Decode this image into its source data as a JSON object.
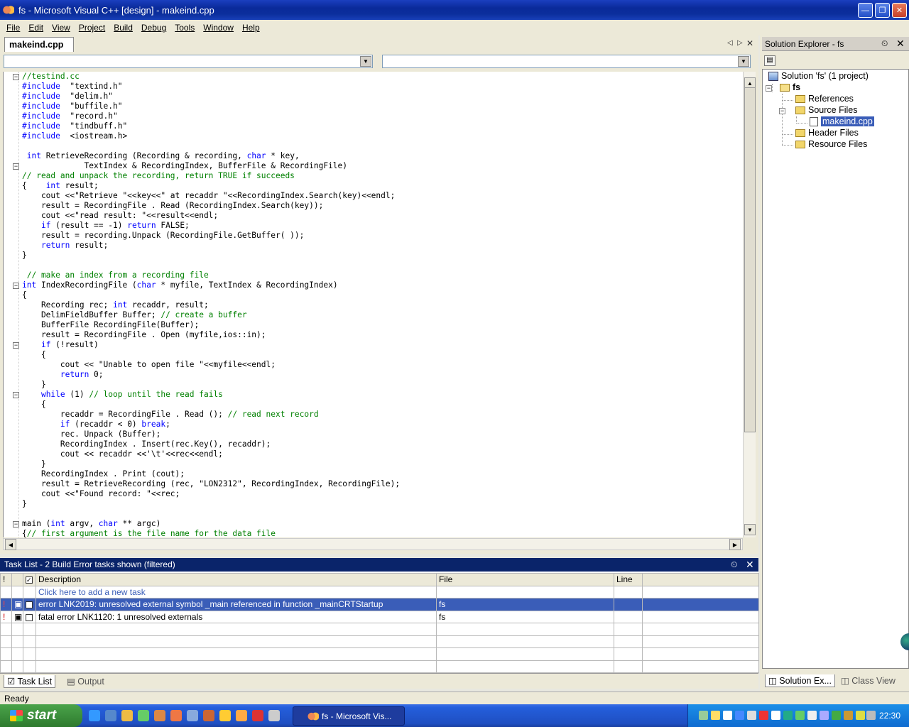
{
  "window": {
    "title": "fs - Microsoft Visual C++ [design] - makeind.cpp"
  },
  "menu": [
    "File",
    "Edit",
    "View",
    "Project",
    "Build",
    "Debug",
    "Tools",
    "Window",
    "Help"
  ],
  "editor": {
    "tab": "makeind.cpp",
    "lines": [
      [
        [
          "cm",
          "//testind.cc"
        ]
      ],
      [
        [
          "kw",
          "#include"
        ],
        [
          "",
          "  \"textind.h\""
        ]
      ],
      [
        [
          "kw",
          "#include"
        ],
        [
          "",
          "  \"delim.h\""
        ]
      ],
      [
        [
          "kw",
          "#include"
        ],
        [
          "",
          "  \"buffile.h\""
        ]
      ],
      [
        [
          "kw",
          "#include"
        ],
        [
          "",
          "  \"record.h\""
        ]
      ],
      [
        [
          "kw",
          "#include"
        ],
        [
          "",
          "  \"tindbuff.h\""
        ]
      ],
      [
        [
          "kw",
          "#include"
        ],
        [
          "",
          "  <iostream.h>"
        ]
      ],
      [
        [
          "",
          ""
        ]
      ],
      [
        [
          "kw",
          " int"
        ],
        [
          "",
          " RetrieveRecording (Recording & recording, "
        ],
        [
          "kw",
          "char"
        ],
        [
          "",
          " * key,"
        ]
      ],
      [
        [
          "",
          "             TextIndex & RecordingIndex, BufferFile & RecordingFile)"
        ]
      ],
      [
        [
          "cm",
          "// read and unpack the recording, return TRUE if succeeds"
        ]
      ],
      [
        [
          "",
          "{    "
        ],
        [
          "kw",
          "int"
        ],
        [
          "",
          " result;"
        ]
      ],
      [
        [
          "",
          "    cout <<\"Retrieve \"<<key<<\" at recaddr \"<<RecordingIndex.Search(key)<<endl;"
        ]
      ],
      [
        [
          "",
          "    result = RecordingFile . Read (RecordingIndex.Search(key));"
        ]
      ],
      [
        [
          "",
          "    cout <<\"read result: \"<<result<<endl;"
        ]
      ],
      [
        [
          "",
          "    "
        ],
        [
          "kw",
          "if"
        ],
        [
          "",
          " (result == -1) "
        ],
        [
          "kw",
          "return"
        ],
        [
          "",
          " FALSE;"
        ]
      ],
      [
        [
          "",
          "    result = recording.Unpack (RecordingFile.GetBuffer( ));"
        ]
      ],
      [
        [
          "",
          "    "
        ],
        [
          "kw",
          "return"
        ],
        [
          "",
          " result;"
        ]
      ],
      [
        [
          "",
          "}"
        ]
      ],
      [
        [
          "",
          ""
        ]
      ],
      [
        [
          "cm",
          " // make an index from a recording file"
        ]
      ],
      [
        [
          "kw",
          "int"
        ],
        [
          "",
          " IndexRecordingFile ("
        ],
        [
          "kw",
          "char"
        ],
        [
          "",
          " * myfile, TextIndex & RecordingIndex)"
        ]
      ],
      [
        [
          "",
          "{"
        ]
      ],
      [
        [
          "",
          "    Recording rec; "
        ],
        [
          "kw",
          "int"
        ],
        [
          "",
          " recaddr, result;"
        ]
      ],
      [
        [
          "",
          "    DelimFieldBuffer Buffer; "
        ],
        [
          "cm",
          "// create a buffer"
        ]
      ],
      [
        [
          "",
          "    BufferFile RecordingFile(Buffer);"
        ]
      ],
      [
        [
          "",
          "    result = RecordingFile . Open (myfile,ios::in);"
        ]
      ],
      [
        [
          "",
          "    "
        ],
        [
          "kw",
          "if"
        ],
        [
          "",
          " (!result)"
        ]
      ],
      [
        [
          "",
          "    {"
        ]
      ],
      [
        [
          "",
          "        cout << \"Unable to open file \"<<myfile<<endl;"
        ]
      ],
      [
        [
          "",
          "        "
        ],
        [
          "kw",
          "return"
        ],
        [
          "",
          " 0;"
        ]
      ],
      [
        [
          "",
          "    }"
        ]
      ],
      [
        [
          "",
          "    "
        ],
        [
          "kw",
          "while"
        ],
        [
          "",
          " (1) "
        ],
        [
          "cm",
          "// loop until the read fails"
        ]
      ],
      [
        [
          "",
          "    {"
        ]
      ],
      [
        [
          "",
          "        recaddr = RecordingFile . Read (); "
        ],
        [
          "cm",
          "// read next record"
        ]
      ],
      [
        [
          "",
          "        "
        ],
        [
          "kw",
          "if"
        ],
        [
          "",
          " (recaddr < 0) "
        ],
        [
          "kw",
          "break"
        ],
        [
          "",
          ";"
        ]
      ],
      [
        [
          "",
          "        rec. Unpack (Buffer);"
        ]
      ],
      [
        [
          "",
          "        RecordingIndex . Insert(rec.Key(), recaddr);"
        ]
      ],
      [
        [
          "",
          "        cout << recaddr <<'\\t'<<rec<<endl;"
        ]
      ],
      [
        [
          "",
          "    }"
        ]
      ],
      [
        [
          "",
          "    RecordingIndex . Print (cout);"
        ]
      ],
      [
        [
          "",
          "    result = RetrieveRecording (rec, \"LON2312\", RecordingIndex, RecordingFile);"
        ]
      ],
      [
        [
          "",
          "    cout <<\"Found record: \"<<rec;"
        ]
      ],
      [
        [
          "",
          "}"
        ]
      ],
      [
        [
          "",
          ""
        ]
      ],
      [
        [
          "",
          "main ("
        ],
        [
          "kw",
          "int"
        ],
        [
          "",
          " argv, "
        ],
        [
          "kw",
          "char"
        ],
        [
          "",
          " ** argc)"
        ]
      ],
      [
        [
          "",
          "{"
        ],
        [
          "cm",
          "// first argument is the file name for the data file"
        ]
      ]
    ]
  },
  "tasklist": {
    "title": "Task List - 2 Build Error tasks shown (filtered)",
    "columns": {
      "priority": "!",
      "desc": "Description",
      "file": "File",
      "line": "Line"
    },
    "add_task": "Click here to add a new task",
    "rows": [
      {
        "desc": "error LNK2019: unresolved external symbol _main referenced in function _mainCRTStartup",
        "file": "fs",
        "line": "",
        "selected": true
      },
      {
        "desc": "fatal error LNK1120: 1 unresolved externals",
        "file": "fs",
        "line": "",
        "selected": false
      }
    ]
  },
  "bottom_tabs": [
    "Task List",
    "Output"
  ],
  "solution_explorer": {
    "title": "Solution Explorer - fs",
    "solution": "Solution 'fs' (1 project)",
    "project": "fs",
    "items": [
      "References",
      "Source Files",
      "makeind.cpp",
      "Header Files",
      "Resource Files"
    ],
    "tabs": [
      "Solution Ex...",
      "Class View"
    ]
  },
  "status": "Ready",
  "taskbar": {
    "start": "start",
    "task": "fs - Microsoft Vis...",
    "clock": "22:30"
  },
  "colors": {
    "titlebar": "#0a2a9a",
    "keyword": "#0000ff",
    "comment": "#008000",
    "selection": "#3a5db8"
  }
}
